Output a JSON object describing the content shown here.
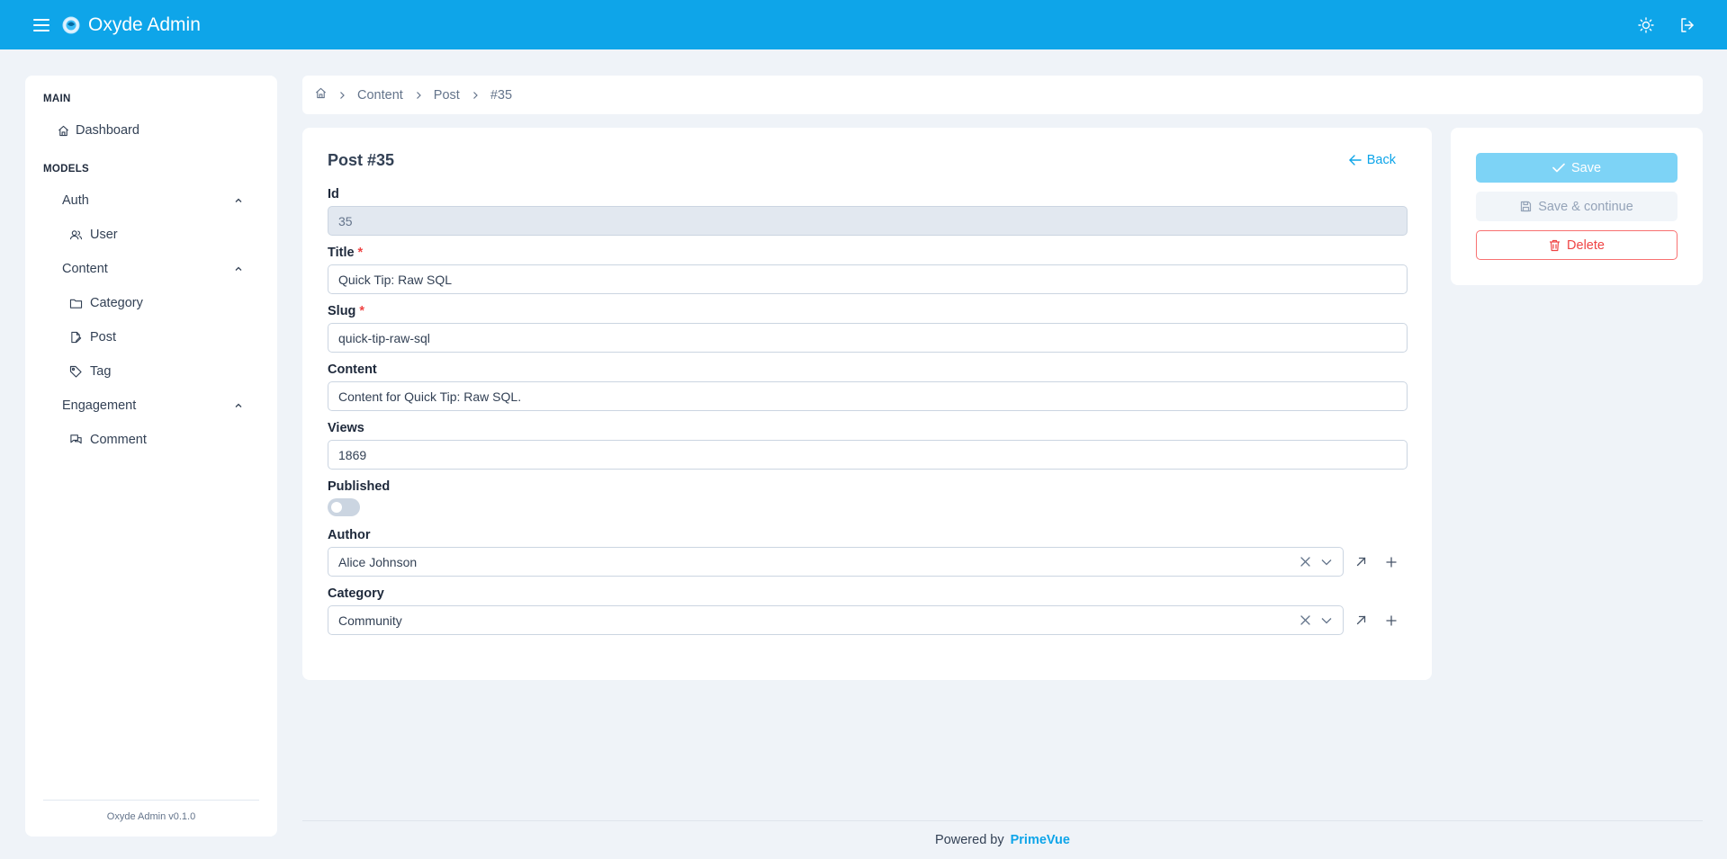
{
  "app": {
    "title": "Oxyde Admin",
    "accent_color": "#0ea5e9"
  },
  "topbar": {
    "menu_icon": "hamburger-icon",
    "theme_icon": "sun-icon",
    "logout_icon": "sign-out-icon"
  },
  "sidebar": {
    "main_label": "MAIN",
    "dashboard_label": "Dashboard",
    "models_label": "MODELS",
    "groups": [
      {
        "label": "Auth",
        "items": [
          {
            "label": "User",
            "icon": "users-icon"
          }
        ]
      },
      {
        "label": "Content",
        "items": [
          {
            "label": "Category",
            "icon": "folder-icon"
          },
          {
            "label": "Post",
            "icon": "file-edit-icon"
          },
          {
            "label": "Tag",
            "icon": "tag-icon"
          }
        ]
      },
      {
        "label": "Engagement",
        "items": [
          {
            "label": "Comment",
            "icon": "comments-icon"
          }
        ]
      }
    ],
    "footer": "Oxyde Admin v0.1.0"
  },
  "breadcrumb": {
    "home_icon": "home-icon",
    "items": [
      "Content",
      "Post",
      "#35"
    ]
  },
  "form": {
    "title": "Post #35",
    "back_label": "Back",
    "fields": {
      "id": {
        "label": "Id",
        "value": "35"
      },
      "title": {
        "label": "Title",
        "required_mark": "*",
        "value": "Quick Tip: Raw SQL"
      },
      "slug": {
        "label": "Slug",
        "required_mark": "*",
        "value": "quick-tip-raw-sql"
      },
      "content": {
        "label": "Content",
        "value": "Content for Quick Tip: Raw SQL."
      },
      "views": {
        "label": "Views",
        "value": "1869"
      },
      "published": {
        "label": "Published",
        "checked": false
      },
      "author": {
        "label": "Author",
        "value": "Alice Johnson"
      },
      "category": {
        "label": "Category",
        "value": "Community"
      }
    }
  },
  "actions": {
    "save": "Save",
    "save_continue": "Save & continue",
    "delete": "Delete"
  },
  "footer": {
    "prefix": "Powered by",
    "brand": "PrimeVue"
  }
}
